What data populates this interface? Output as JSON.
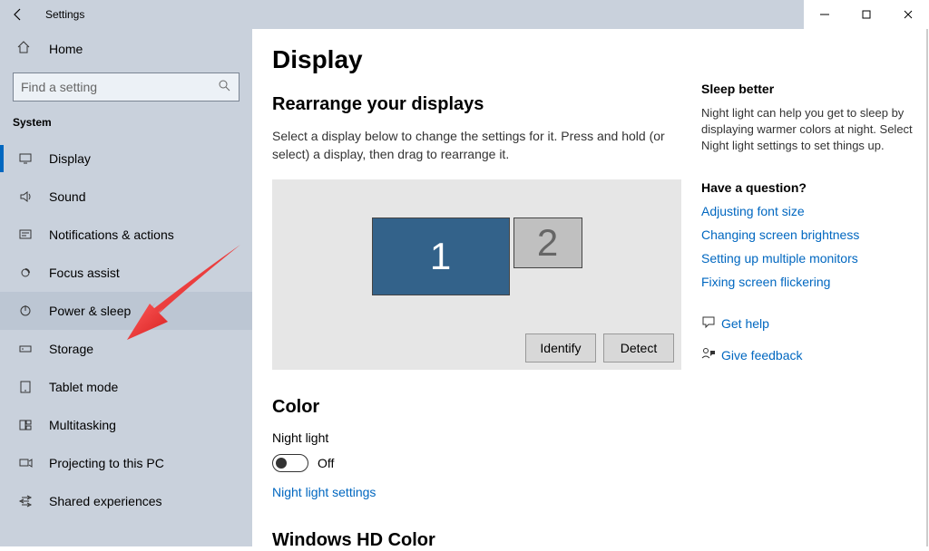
{
  "window": {
    "title": "Settings"
  },
  "sidebar": {
    "home": "Home",
    "search_placeholder": "Find a setting",
    "category": "System",
    "items": [
      {
        "icon": "display",
        "label": "Display",
        "active": true
      },
      {
        "icon": "sound",
        "label": "Sound"
      },
      {
        "icon": "notifications",
        "label": "Notifications & actions"
      },
      {
        "icon": "focus",
        "label": "Focus assist"
      },
      {
        "icon": "power",
        "label": "Power & sleep",
        "hovered": true
      },
      {
        "icon": "storage",
        "label": "Storage"
      },
      {
        "icon": "tablet",
        "label": "Tablet mode"
      },
      {
        "icon": "multitask",
        "label": "Multitasking"
      },
      {
        "icon": "project",
        "label": "Projecting to this PC"
      },
      {
        "icon": "shared",
        "label": "Shared experiences"
      }
    ]
  },
  "main": {
    "title": "Display",
    "rearrange": {
      "heading": "Rearrange your displays",
      "desc": "Select a display below to change the settings for it. Press and hold (or select) a display, then drag to rearrange it.",
      "monitors": [
        "1",
        "2"
      ],
      "identify": "Identify",
      "detect": "Detect"
    },
    "color": {
      "heading": "Color",
      "night_light_label": "Night light",
      "night_light_state": "Off",
      "night_light_link": "Night light settings"
    },
    "hd": {
      "heading": "Windows HD Color"
    }
  },
  "right": {
    "sleep": {
      "title": "Sleep better",
      "text": "Night light can help you get to sleep by displaying warmer colors at night. Select Night light settings to set things up."
    },
    "question": {
      "title": "Have a question?",
      "links": [
        "Adjusting font size",
        "Changing screen brightness",
        "Setting up multiple monitors",
        "Fixing screen flickering"
      ]
    },
    "help": "Get help",
    "feedback": "Give feedback"
  }
}
